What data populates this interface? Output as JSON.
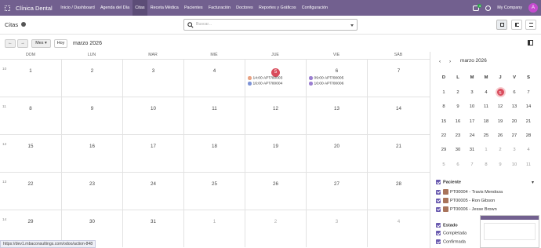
{
  "nav": {
    "brand": "Clínica Dental",
    "items": [
      "Inicio / Dashboard",
      "Agenda del Día",
      "Citas",
      "Receta Médica",
      "Pacientes",
      "Facturación",
      "Doctores",
      "Reportes y Gráficos",
      "Configuración"
    ],
    "active_index": 2,
    "chat_badge": "4",
    "company": "My Company",
    "avatar_letter": "A"
  },
  "control": {
    "title": "Citas",
    "search_placeholder": "Buscar..."
  },
  "toolbar": {
    "prev": "←",
    "next": "→",
    "scale": "Mes",
    "today": "Hoy",
    "month_label": "marzo 2026"
  },
  "calendar": {
    "day_headers": [
      "DOM",
      "LUN",
      "MAR",
      "MIÉ",
      "JUE",
      "VIE",
      "SÁB"
    ],
    "week_numbers": [
      "10",
      "11",
      "12",
      "13",
      "14"
    ],
    "weeks": [
      [
        {
          "d": "1"
        },
        {
          "d": "2"
        },
        {
          "d": "3"
        },
        {
          "d": "4"
        },
        {
          "d": "5",
          "today": true
        },
        {
          "d": "6"
        },
        {
          "d": "7"
        }
      ],
      [
        {
          "d": "8"
        },
        {
          "d": "9"
        },
        {
          "d": "10"
        },
        {
          "d": "11"
        },
        {
          "d": "12"
        },
        {
          "d": "13"
        },
        {
          "d": "14"
        }
      ],
      [
        {
          "d": "15"
        },
        {
          "d": "16"
        },
        {
          "d": "17"
        },
        {
          "d": "18"
        },
        {
          "d": "19"
        },
        {
          "d": "20"
        },
        {
          "d": "21"
        }
      ],
      [
        {
          "d": "22"
        },
        {
          "d": "23"
        },
        {
          "d": "24"
        },
        {
          "d": "25"
        },
        {
          "d": "26"
        },
        {
          "d": "27"
        },
        {
          "d": "28"
        }
      ],
      [
        {
          "d": "29"
        },
        {
          "d": "30"
        },
        {
          "d": "31"
        },
        {
          "d": "1",
          "other": true
        },
        {
          "d": "2",
          "other": true
        },
        {
          "d": "3",
          "other": true
        },
        {
          "d": "4",
          "other": true
        }
      ]
    ],
    "events": [
      {
        "week": 0,
        "day": 4,
        "row": 0,
        "text": "14:00 APT/00003",
        "color": "#e8a283"
      },
      {
        "week": 0,
        "day": 4,
        "row": 1,
        "text": "16:00 APT/00004",
        "color": "#7d93d6"
      },
      {
        "week": 0,
        "day": 5,
        "row": 0,
        "text": "09:00 APT/00005",
        "color": "#9b7fd1"
      },
      {
        "week": 0,
        "day": 5,
        "row": 1,
        "text": "16:00 APT/00006",
        "color": "#9b7fd1"
      }
    ]
  },
  "mini": {
    "month_label": "marzo 2026",
    "prev": "‹",
    "next": "›",
    "headers": [
      "D",
      "L",
      "M",
      "M",
      "J",
      "V",
      "S"
    ],
    "weeks": [
      [
        {
          "d": "1"
        },
        {
          "d": "2"
        },
        {
          "d": "3"
        },
        {
          "d": "4"
        },
        {
          "d": "5",
          "today": true
        },
        {
          "d": "6"
        },
        {
          "d": "7"
        }
      ],
      [
        {
          "d": "8"
        },
        {
          "d": "9"
        },
        {
          "d": "10"
        },
        {
          "d": "11"
        },
        {
          "d": "12"
        },
        {
          "d": "13"
        },
        {
          "d": "14"
        }
      ],
      [
        {
          "d": "15"
        },
        {
          "d": "16"
        },
        {
          "d": "17"
        },
        {
          "d": "18"
        },
        {
          "d": "19"
        },
        {
          "d": "20"
        },
        {
          "d": "21"
        }
      ],
      [
        {
          "d": "22"
        },
        {
          "d": "23"
        },
        {
          "d": "24"
        },
        {
          "d": "25"
        },
        {
          "d": "26"
        },
        {
          "d": "27"
        },
        {
          "d": "28"
        }
      ],
      [
        {
          "d": "29"
        },
        {
          "d": "30"
        },
        {
          "d": "31"
        },
        {
          "d": "1",
          "other": true
        },
        {
          "d": "2",
          "other": true
        },
        {
          "d": "3",
          "other": true
        },
        {
          "d": "4",
          "other": true
        }
      ],
      [
        {
          "d": "5",
          "other": true
        },
        {
          "d": "6",
          "other": true
        },
        {
          "d": "7",
          "other": true
        },
        {
          "d": "8",
          "other": true
        },
        {
          "d": "9",
          "other": true
        },
        {
          "d": "10",
          "other": true
        },
        {
          "d": "11",
          "other": true
        }
      ]
    ]
  },
  "filters": {
    "patient_title": "Paciente",
    "patients": [
      "PT00004 - Travis Mendoza",
      "PT00005 - Ron Gibson",
      "PT00006 - Jesse Brown"
    ],
    "state_title": "Estado",
    "states": [
      "Completada",
      "Confirmada"
    ]
  },
  "status_url": "https://dev1.mbaconsultings.com/odoo/action-848"
}
